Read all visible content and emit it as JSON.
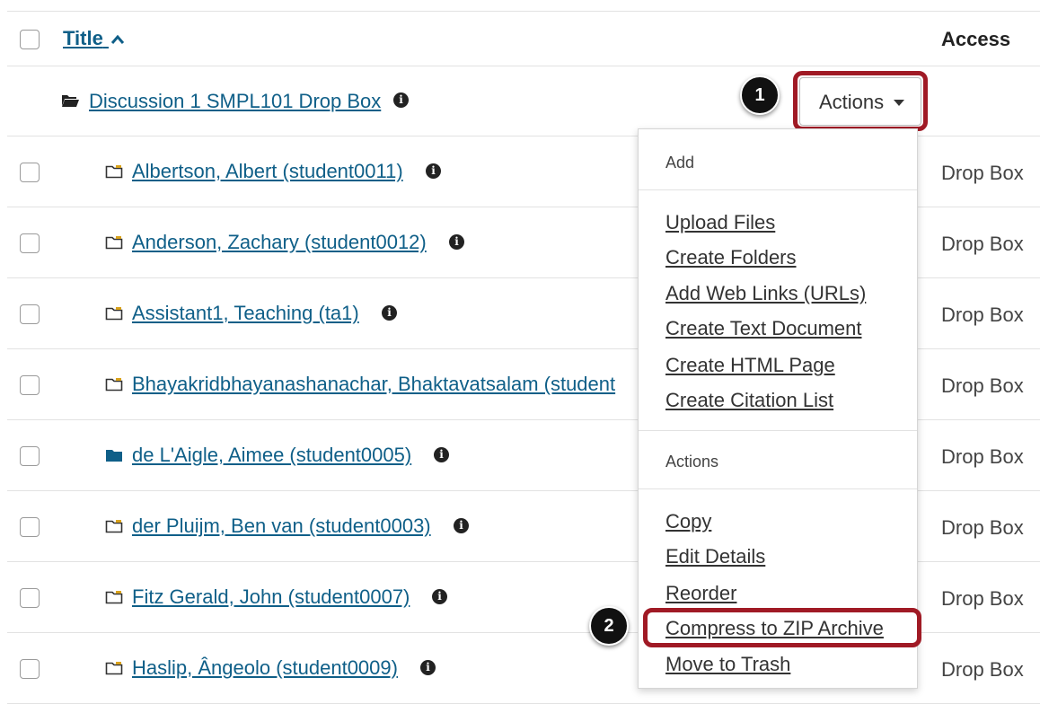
{
  "header": {
    "title_label": "Title",
    "sort_icon": "chevron-up-icon",
    "access_label": "Access"
  },
  "parent_folder": {
    "icon": "folder-open-icon",
    "label": "Discussion 1 SMPL101 Drop Box ",
    "actions_button": "Actions"
  },
  "rows": [
    {
      "label": "Albertson, Albert (student0011) ",
      "access": "Drop Box",
      "icon": "folder-outline-icon"
    },
    {
      "label": "Anderson, Zachary (student0012) ",
      "access": "Drop Box",
      "icon": "folder-outline-icon"
    },
    {
      "label": "Assistant1, Teaching (ta1) ",
      "access": "Drop Box",
      "icon": "folder-outline-icon"
    },
    {
      "label": "Bhayakridbhayanashanachar, Bhaktavatsalam (student",
      "access": "Drop Box",
      "icon": "folder-outline-icon"
    },
    {
      "label": "de L'Aigle, Aimee (student0005) ",
      "access": "Drop Box",
      "icon": "folder-filled-icon"
    },
    {
      "label": "der Pluijm, Ben van (student0003) ",
      "access": "Drop Box",
      "icon": "folder-outline-icon"
    },
    {
      "label": "Fitz Gerald, John (student0007) ",
      "access": "Drop Box",
      "icon": "folder-outline-icon"
    },
    {
      "label": "Haslip, Ângeolo (student0009) ",
      "access": "Drop Box",
      "icon": "folder-outline-icon"
    }
  ],
  "menu": {
    "add_header": "Add",
    "add_items": [
      "Upload Files",
      "Create Folders",
      "Add Web Links (URLs)",
      "Create Text Document",
      "Create HTML Page",
      "Create Citation List"
    ],
    "actions_header": "Actions",
    "action_items": [
      "Copy",
      "Edit Details",
      "Reorder",
      "Compress to ZIP Archive",
      "Move to Trash"
    ]
  },
  "callouts": [
    "1",
    "2"
  ],
  "colors": {
    "link": "#0f5f88",
    "highlight": "#a01a25",
    "folder_icon": "#d9a21b",
    "folder_filled": "#0f5f88"
  }
}
